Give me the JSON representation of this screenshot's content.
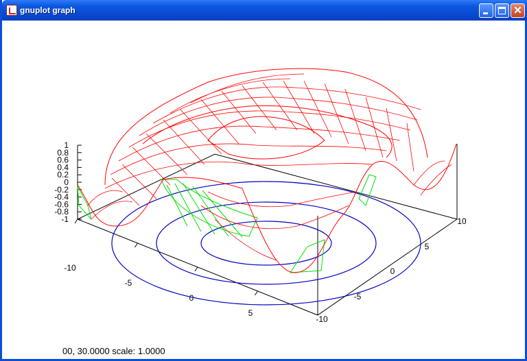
{
  "window": {
    "title": "gnuplot graph",
    "buttons": {
      "minimize": "minimize",
      "maximize": "maximize",
      "close": "close"
    }
  },
  "colors": {
    "surface_top": "#ff0000",
    "surface_bottom": "#00e000",
    "contour": "#0000c0",
    "axes": "#000000"
  },
  "status_line": "00,  30.0000   scale:  1.0000",
  "chart_data": {
    "type": "surface",
    "z_ticks": [
      "1",
      "0.8",
      "0.6",
      "0.4",
      "0.2",
      "0",
      "-0.2",
      "-0.4",
      "-0.6",
      "-0.8",
      "-1"
    ],
    "x_ticks": [
      "-10",
      "-5",
      "0",
      "5"
    ],
    "y_ticks": [
      "-10",
      "-5",
      "0",
      "5",
      "10"
    ],
    "xlim": [
      -10,
      10
    ],
    "ylim": [
      -10,
      10
    ],
    "zlim": [
      -1,
      1
    ],
    "contours": true,
    "grid": false
  }
}
